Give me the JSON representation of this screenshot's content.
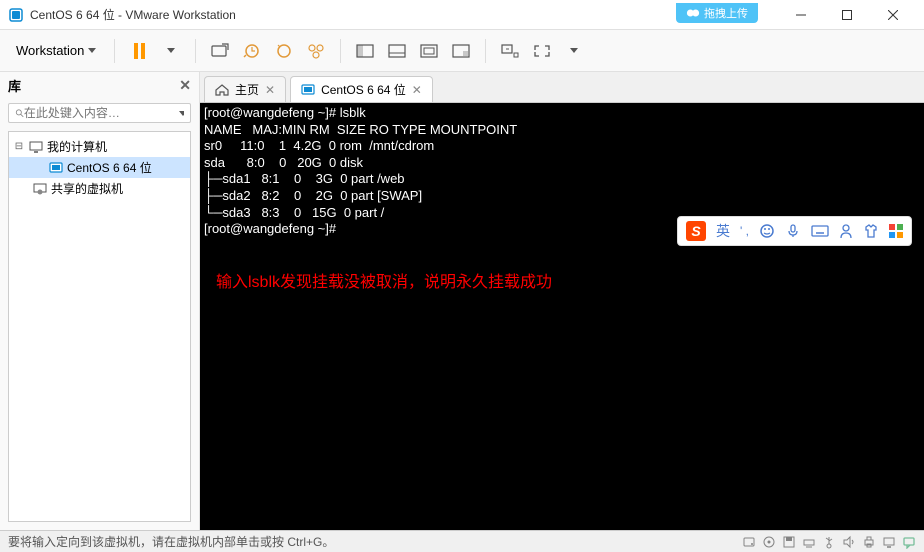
{
  "window": {
    "title": "CentOS 6 64 位 - VMware Workstation",
    "upload_label": "拖拽上传"
  },
  "menu": {
    "workstation": "Workstation"
  },
  "sidebar": {
    "title": "库",
    "search_placeholder": "在此处键入内容…",
    "tree": {
      "root": "我的计算机",
      "vm1": "CentOS 6 64 位",
      "shared": "共享的虚拟机"
    }
  },
  "tabs": {
    "home": "主页",
    "vm": "CentOS 6 64 位"
  },
  "terminal": {
    "lines": [
      "[root@wangdefeng ~]# lsblk",
      "NAME   MAJ:MIN RM  SIZE RO TYPE MOUNTPOINT",
      "sr0     11:0    1  4.2G  0 rom  /mnt/cdrom",
      "sda      8:0    0   20G  0 disk ",
      "├─sda1   8:1    0    3G  0 part /web",
      "├─sda2   8:2    0    2G  0 part [SWAP]",
      "└─sda3   8:3    0   15G  0 part /",
      "[root@wangdefeng ~]# "
    ],
    "annotation": "输入lsblk发现挂载没被取消，说明永久挂载成功"
  },
  "status": {
    "text": "要将输入定向到该虚拟机，请在虚拟机内部单击或按 Ctrl+G。"
  },
  "ime": {
    "logo": "S",
    "lang": "英",
    "punct": "' ,"
  }
}
